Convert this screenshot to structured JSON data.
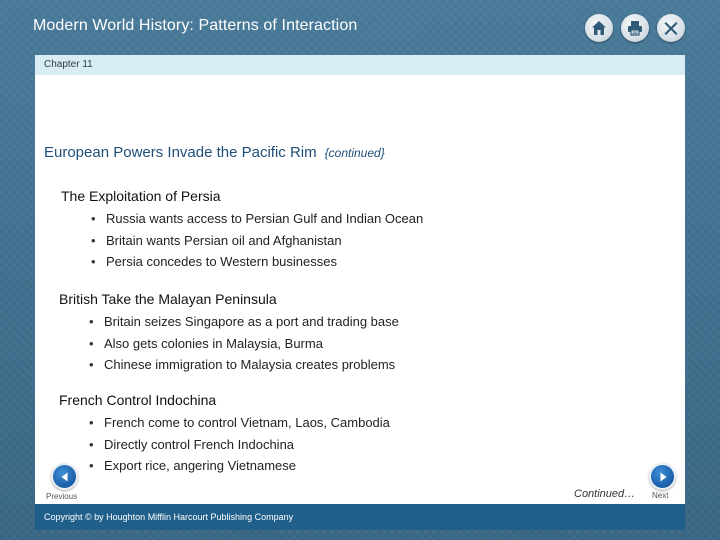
{
  "header": {
    "app_title": "Modern World History: Patterns of Interaction",
    "icons": [
      "home-icon",
      "print-icon",
      "close-icon"
    ]
  },
  "chapter": {
    "label": "Chapter 11"
  },
  "slide": {
    "title": "European Powers Invade the Pacific Rim",
    "continued_tag": "{continued}",
    "sections": [
      {
        "heading": "The Exploitation of Persia",
        "bullets": [
          "Russia wants access to Persian Gulf and Indian Ocean",
          "Britain wants Persian oil and Afghanistan",
          "Persia concedes to Western businesses"
        ]
      },
      {
        "heading": "British Take the Malayan Peninsula",
        "bullets": [
          "Britain seizes Singapore as a port and trading base",
          "Also gets colonies in Malaysia, Burma",
          "Chinese immigration to Malaysia creates problems"
        ]
      },
      {
        "heading": "French Control Indochina",
        "bullets": [
          "French come to control Vietnam, Laos, Cambodia",
          "Directly control French Indochina",
          "Export rice, angering Vietnamese"
        ]
      }
    ]
  },
  "nav": {
    "previous_label": "Previous",
    "next_label": "Next",
    "continued_label": "Continued…"
  },
  "footer": {
    "copyright": "Copyright © by Houghton Mifflin Harcourt Publishing Company"
  },
  "colors": {
    "frame_bg": "#3f6e8c",
    "chapter_bar": "#d8ecf6",
    "title_blue": "#1f4e79",
    "footer_bar": "#1f5f8a",
    "nav_button": "#1a5ea8"
  }
}
